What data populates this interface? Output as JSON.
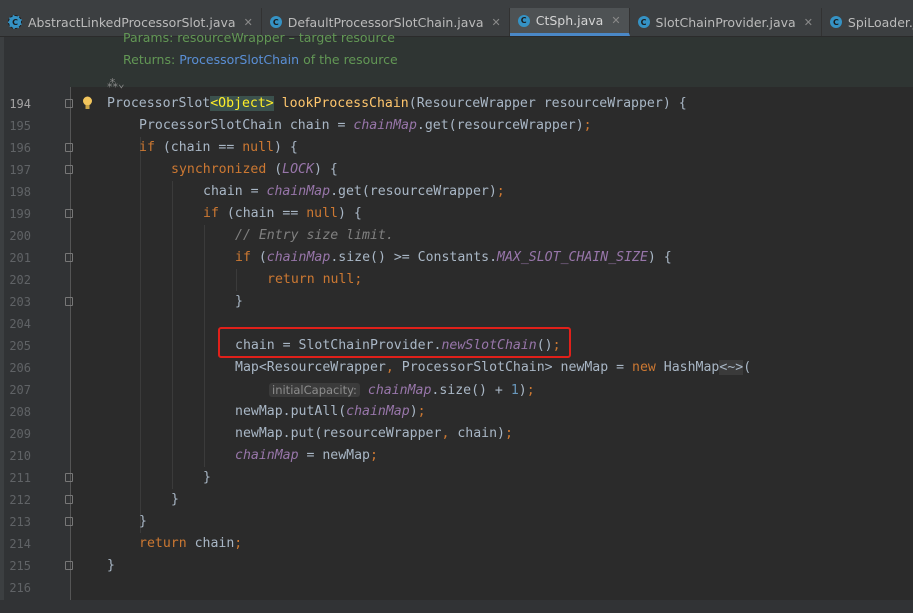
{
  "tabs": [
    {
      "label": "AbstractLinkedProcessorSlot.java",
      "icon": "abstract-class-icon",
      "active": false
    },
    {
      "label": "DefaultProcessorSlotChain.java",
      "icon": "class-icon",
      "active": false
    },
    {
      "label": "CtSph.java",
      "icon": "class-icon",
      "active": true
    },
    {
      "label": "SlotChainProvider.java",
      "icon": "class-icon",
      "active": false
    },
    {
      "label": "SpiLoader.java",
      "icon": "class-icon",
      "active": false
    }
  ],
  "doc": {
    "params_text": "Params: resourceWrapper – target resource",
    "returns_label": "Returns:",
    "returns_link": "ProcessorSlotChain",
    "returns_rest": "of the resource"
  },
  "lines": [
    {
      "n": "194"
    },
    {
      "n": "195"
    },
    {
      "n": "196"
    },
    {
      "n": "197"
    },
    {
      "n": "198"
    },
    {
      "n": "199"
    },
    {
      "n": "200"
    },
    {
      "n": "201"
    },
    {
      "n": "202"
    },
    {
      "n": "203"
    },
    {
      "n": "204"
    },
    {
      "n": "205"
    },
    {
      "n": "206"
    },
    {
      "n": "207"
    },
    {
      "n": "208"
    },
    {
      "n": "209"
    },
    {
      "n": "210"
    },
    {
      "n": "211"
    },
    {
      "n": "212"
    },
    {
      "n": "213"
    },
    {
      "n": "214"
    },
    {
      "n": "215"
    },
    {
      "n": "216"
    }
  ],
  "code": {
    "l194": {
      "t1": "ProcessorSlot",
      "t2": "<Object>",
      "t3": " ",
      "t4": "lookProcessChain",
      "t5": "(ResourceWrapper resourceWrapper) {"
    },
    "l195": {
      "t1": "ProcessorSlotChain chain = ",
      "t2": "chainMap",
      "t3": ".get(resourceWrapper)",
      "t4": ";"
    },
    "l196": {
      "t1": "if",
      "t2": " (chain == ",
      "t3": "null",
      "t4": ") {"
    },
    "l197": {
      "t1": "synchronized",
      "t2": " (",
      "t3": "LOCK",
      "t4": ") {"
    },
    "l198": {
      "t1": "chain = ",
      "t2": "chainMap",
      "t3": ".get(resourceWrapper)",
      "t4": ";"
    },
    "l199": {
      "t1": "if",
      "t2": " (chain == ",
      "t3": "null",
      "t4": ") {"
    },
    "l200": {
      "t1": "// Entry size limit."
    },
    "l201": {
      "t1": "if",
      "t2": " (",
      "t3": "chainMap",
      "t4": ".size() >= Constants.",
      "t5": "MAX_SLOT_CHAIN_SIZE",
      "t6": ") {"
    },
    "l202": {
      "t1": "return",
      "t2": " ",
      "t3": "null",
      "t4": ";"
    },
    "l203": {
      "t1": "}"
    },
    "l205": {
      "t1": "chain = SlotChainProvider.",
      "t2": "newSlotChain",
      "t3": "()",
      "t4": ";"
    },
    "l206": {
      "t1": "Map<ResourceWrapper",
      "t2": ",",
      "t3": " ProcessorSlotChain> newMap = ",
      "t4": "new",
      "t5": " HashMap",
      "t6": "<~>",
      "t7": "("
    },
    "l207": {
      "hint": "initialCapacity:",
      "t2": "chainMap",
      "t3": ".size() + ",
      "t4": "1",
      "t5": ")",
      "t6": ";"
    },
    "l208": {
      "t1": "newMap.putAll(",
      "t2": "chainMap",
      "t3": ")",
      "t4": ";"
    },
    "l209": {
      "t1": "newMap.put(resourceWrapper",
      "t2": ",",
      "t3": " chain)",
      "t4": ";"
    },
    "l210": {
      "t1": "chainMap",
      "t2": " = newMap",
      "t3": ";"
    },
    "l211": {
      "t1": "}"
    },
    "l212": {
      "t1": "}"
    },
    "l213": {
      "t1": "}"
    },
    "l214": {
      "t1": "return",
      "t2": " chain",
      "t3": ";"
    },
    "l215": {
      "t1": "}"
    }
  },
  "colors": {
    "background": "#2b2b2b",
    "keyword": "#cc7832",
    "field": "#9876aa",
    "method": "#ffc66d",
    "comment": "#808080",
    "number": "#6897bb",
    "highlight_box": "#e0201a"
  }
}
